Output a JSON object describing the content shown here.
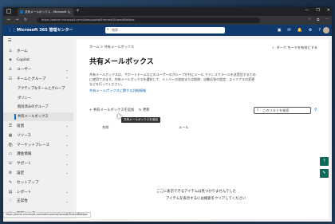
{
  "browser": {
    "tab_title": "共有メールボックス - Microsoft 365 ...",
    "tab_close": "✕",
    "new_tab": "+",
    "url": "https://admin.microsoft.com/Adminportal/Home#/SharedMailbox",
    "window_controls": [
      "—",
      "❐",
      "✕"
    ]
  },
  "header": {
    "app_title": "Microsoft 365 管理センター",
    "search_placeholder": "検索"
  },
  "nav": {
    "items": [
      {
        "label": "ホーム",
        "icon": "⌂"
      },
      {
        "label": "Copilot",
        "icon": "◈"
      },
      {
        "label": "ユーザー",
        "icon": "♙",
        "chevron": "⌄"
      },
      {
        "label": "チームとグループ",
        "icon": "☷",
        "chevron": "⌃"
      },
      {
        "label": "アクティブなチームとグループ",
        "sub": true
      },
      {
        "label": "ポリシー",
        "sub": true
      },
      {
        "label": "削除済みのグループ",
        "sub": true
      },
      {
        "label": "共有メールボックス",
        "sub": true,
        "selected": true
      },
      {
        "label": "役割",
        "icon": "⚿",
        "chevron": "⌄"
      },
      {
        "label": "リソース",
        "icon": "▦",
        "chevron": "⌄"
      },
      {
        "label": "マーケットプレース",
        "icon": "🛍",
        "chevron": "⌄"
      },
      {
        "label": "課金情報",
        "icon": "▭",
        "chevron": "⌄"
      },
      {
        "label": "サポート",
        "icon": "☏",
        "chevron": "⌄"
      },
      {
        "label": "設定",
        "icon": "⚙",
        "chevron": "⌄"
      },
      {
        "label": "セットアップ",
        "icon": "✎"
      },
      {
        "label": "レポート",
        "icon": "▤",
        "chevron": "⌄"
      },
      {
        "label": "正常性",
        "icon": "♡",
        "chevron": "⌄"
      }
    ],
    "bottom_label": "管理センター",
    "status_url": "https://admin.microsoft.com/adminportal/home#/SharedMailbox"
  },
  "main": {
    "breadcrumb": "ホーム  >  共有メールボックス",
    "dark_mode": "ダーク モードを有効にする",
    "title": "共有メールボックス",
    "description": "共有メールボックスは、サポートチームなどのユーザーのグループが共にメール アドレスでメールを送受信するために使用できます。共有メールボックスを選択して、メンバーの追加または削除、自動応答の設定、エイリアスの変更などを行ってください。",
    "learn_link": "共有メールボックスに関する詳細情報",
    "add_button": "共有メールボックスを追加",
    "refresh_button": "更新",
    "tooltip": "共有メールボックスを追加",
    "list_search_placeholder": "このリストを検索",
    "columns": [
      "名前",
      "メール"
    ],
    "empty_line1": "ここに表示できるアイテムは見つかりませんでした",
    "empty_line2": "アイテムを表示するには検索をクリアしてください"
  }
}
